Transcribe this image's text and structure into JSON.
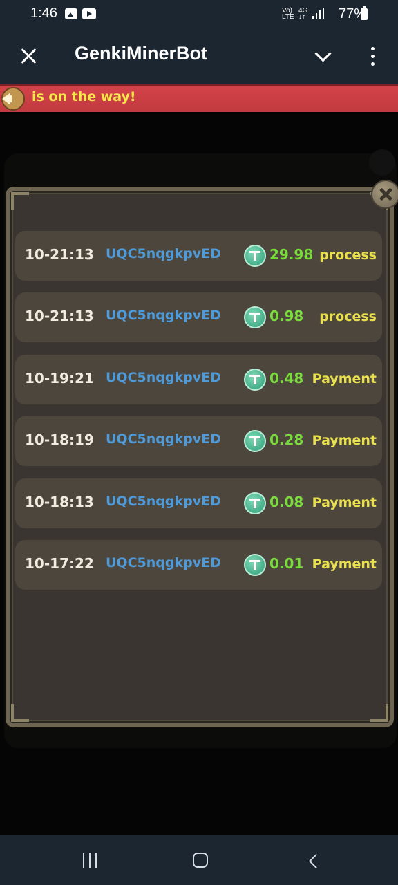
{
  "status_bar": {
    "time": "1:46",
    "network_top": "Vo)",
    "network_bottom": "LTE",
    "data_top": "4G",
    "data_bottom": "↓↑",
    "battery": "77%"
  },
  "app_bar": {
    "title": "GenkiMinerBot"
  },
  "announcement": {
    "text": "is on the way!"
  },
  "withdrawals": [
    {
      "time": "10-21:13",
      "address": "UQC5nqgkpvED...",
      "amount": "29.98",
      "status": "process"
    },
    {
      "time": "10-21:13",
      "address": "UQC5nqgkpvED...",
      "amount": "0.98",
      "status": "process"
    },
    {
      "time": "10-19:21",
      "address": "UQC5nqgkpvED...",
      "amount": "0.48",
      "status": "Payment"
    },
    {
      "time": "10-18:19",
      "address": "UQC5nqgkpvED...",
      "amount": "0.28",
      "status": "Payment"
    },
    {
      "time": "10-18:13",
      "address": "UQC5nqgkpvED...",
      "amount": "0.08",
      "status": "Payment"
    },
    {
      "time": "10-17:22",
      "address": "UQC5nqgkpvED...",
      "amount": "0.01",
      "status": "Payment"
    }
  ],
  "colors": {
    "header_bg": "#1c2631",
    "announcement_bg": "#c23a3f",
    "announcement_text": "#f6e84a",
    "modal_bg": "#3a3530",
    "row_bg": "#4d463c",
    "address": "#4f9ad8",
    "amount": "#7adb3d",
    "status": "#e8e04c"
  }
}
